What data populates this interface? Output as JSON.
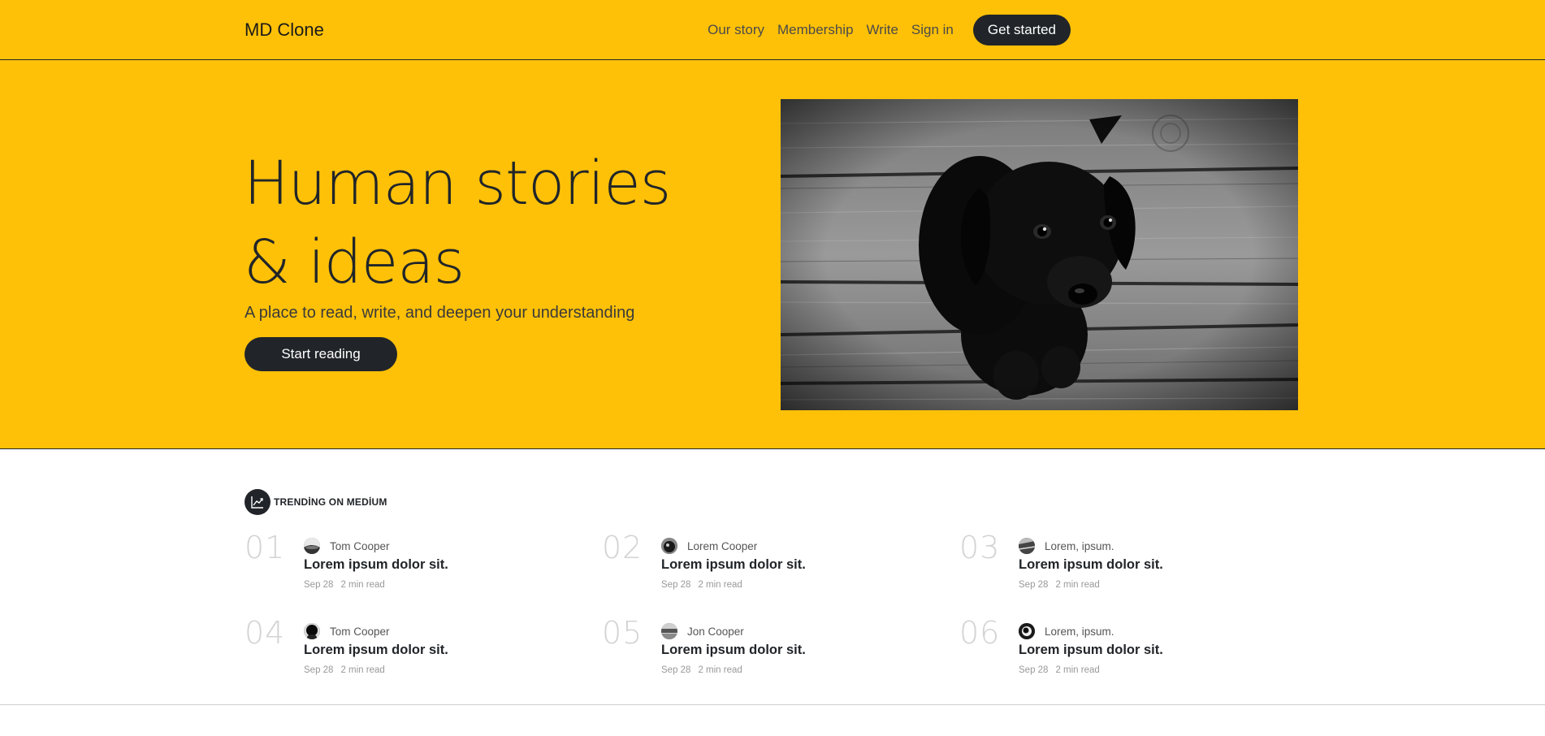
{
  "header": {
    "brand": "MD Clone",
    "nav": [
      "Our story",
      "Membership",
      "Write",
      "Sign in"
    ],
    "cta": "Get started"
  },
  "hero": {
    "title": "Human stories & ideas",
    "subtitle": "A place to read, write, and deepen your understanding",
    "button": "Start reading",
    "image_icon": "black-puppy-photo"
  },
  "colors": {
    "accent": "#ffc107",
    "dark": "#212529",
    "number": "#d3d3d3",
    "muted": "#999999"
  },
  "trending": {
    "title": "TRENDİNG ON MEDİUM",
    "icon": "trend-chart-icon",
    "items": [
      {
        "num": "01",
        "author": "Tom Cooper",
        "title": "Lorem ipsum dolor sit.",
        "date": "Sep 28",
        "read": "2 min read"
      },
      {
        "num": "02",
        "author": "Lorem Cooper",
        "title": "Lorem ipsum dolor sit.",
        "date": "Sep 28",
        "read": "2 min read"
      },
      {
        "num": "03",
        "author": "Lorem, ipsum.",
        "title": "Lorem ipsum dolor sit.",
        "date": "Sep 28",
        "read": "2 min read"
      },
      {
        "num": "04",
        "author": "Tom Cooper",
        "title": "Lorem ipsum dolor sit.",
        "date": "Sep 28",
        "read": "2 min read"
      },
      {
        "num": "05",
        "author": "Jon Cooper",
        "title": "Lorem ipsum dolor sit.",
        "date": "Sep 28",
        "read": "2 min read"
      },
      {
        "num": "06",
        "author": "Lorem, ipsum.",
        "title": "Lorem ipsum dolor sit.",
        "date": "Sep 28",
        "read": "2 min read"
      }
    ]
  }
}
